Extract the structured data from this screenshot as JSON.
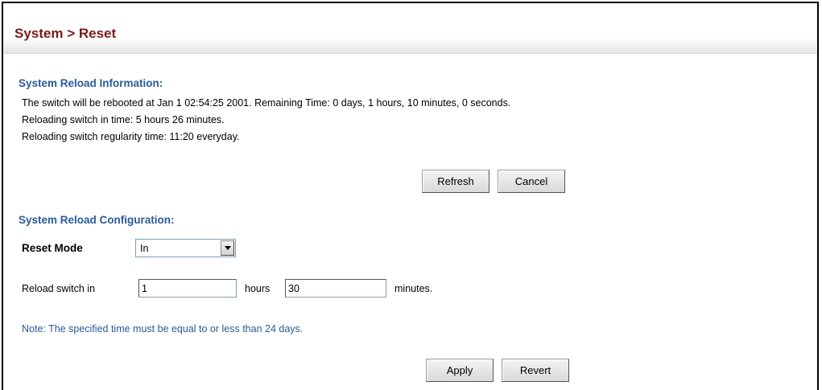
{
  "header": {
    "title": "System > Reset"
  },
  "reload_info": {
    "heading": "System Reload Information:",
    "lines": [
      "The switch will be rebooted at Jan 1 02:54:25 2001. Remaining Time: 0 days, 1 hours, 10 minutes, 0 seconds.",
      "Reloading switch in time: 5 hours 26 minutes.",
      "Reloading switch regularity time: 11:20 everyday."
    ],
    "refresh_label": "Refresh",
    "cancel_label": "Cancel"
  },
  "reload_config": {
    "heading": "System Reload Configuration:",
    "reset_mode_label": "Reset Mode",
    "reset_mode_value": "In",
    "reload_in_label": "Reload switch in",
    "hours_value": "1",
    "hours_label": "hours",
    "minutes_value": "30",
    "minutes_label": "minutes.",
    "note": "Note: The specified time must be equal to or less than 24 days.",
    "apply_label": "Apply",
    "revert_label": "Revert"
  },
  "icons": {
    "dropdown": "chevron-down-icon"
  }
}
